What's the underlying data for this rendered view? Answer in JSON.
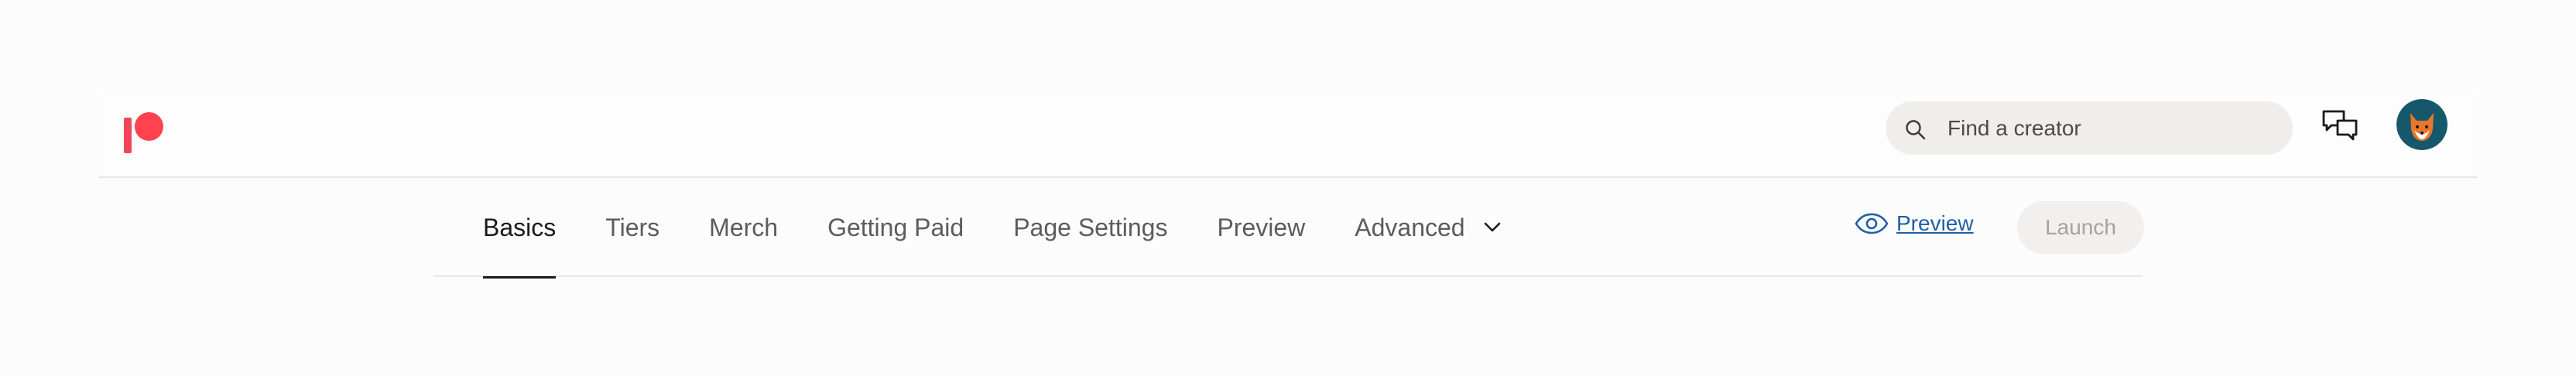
{
  "brand": {
    "name": "Patreon",
    "accent_color": "#ff424d",
    "bar_color": "#f1465a"
  },
  "header": {
    "search": {
      "placeholder": "Find a creator",
      "value": ""
    },
    "icons": {
      "search": "search-icon",
      "messages": "chat-bubbles-icon",
      "avatar": "fox-avatar"
    }
  },
  "subnav": {
    "tabs": [
      {
        "label": "Basics",
        "active": true
      },
      {
        "label": "Tiers",
        "active": false
      },
      {
        "label": "Merch",
        "active": false
      },
      {
        "label": "Getting Paid",
        "active": false
      },
      {
        "label": "Page Settings",
        "active": false
      },
      {
        "label": "Preview",
        "active": false
      },
      {
        "label": "Advanced",
        "active": false,
        "has_dropdown": true
      }
    ],
    "preview_link": "Preview",
    "launch_button": "Launch",
    "launch_disabled": true,
    "link_color": "#1f5ea8"
  }
}
